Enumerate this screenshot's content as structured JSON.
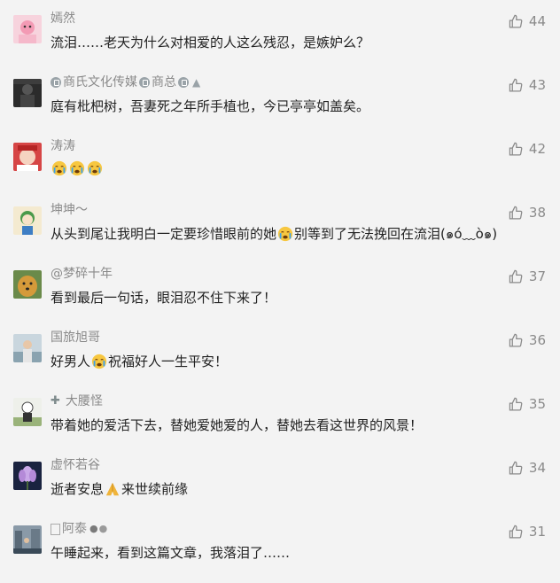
{
  "comments": [
    {
      "name": "嫣然",
      "badge": [],
      "text": [
        "流泪……老天为什么对相爱的人这么残忍，是嫉妒么？"
      ],
      "likes": "44",
      "avatar": "pink-cartoon"
    },
    {
      "name": "商氏文化传媒 商总",
      "badge": [
        "money-bag",
        "money-bag",
        "poop"
      ],
      "text": [
        "庭有枇杷树，吾妻死之年所手植也，今已亭亭如盖矣。"
      ],
      "likes": "43",
      "avatar": "dark-figure"
    },
    {
      "name": "涛涛",
      "badge": [],
      "text": [],
      "emojis": 3,
      "likes": "42",
      "avatar": "red-child"
    },
    {
      "name": "坤坤～",
      "badge": [],
      "text": [
        "从头到尾让我明白一定要珍惜眼前的她",
        "别等到了无法挽回在流泪(๑ó﹏ò๑)"
      ],
      "likes": "38",
      "avatar": "green-cartoon"
    },
    {
      "name": "@梦碎十年",
      "badge": [],
      "text": [
        "看到最后一句话，眼泪忍不住下来了！"
      ],
      "likes": "37",
      "avatar": "golden-dog"
    },
    {
      "name": "国旅旭哥",
      "badge": [],
      "text": [
        "好男人",
        "祝福好人一生平安！"
      ],
      "likes": "36",
      "avatar": "man-outdoor"
    },
    {
      "name": "大腰怪",
      "badge": [
        "cactus"
      ],
      "text": [
        "带着她的爱活下去，替她爱她爱的人，替她去看这世界的风景！"
      ],
      "likes": "35",
      "avatar": "cartoon-figure"
    },
    {
      "name": "虚怀若谷",
      "badge": [],
      "text": [
        "逝者安息",
        "来世续前缘"
      ],
      "likes": "34",
      "avatar": "lotus"
    },
    {
      "name": "阿泰",
      "badge": [
        "square",
        "dog",
        "cat"
      ],
      "text": [
        "午睡起来，看到这篇文章，我落泪了……"
      ],
      "likes": "31",
      "avatar": "city-street"
    }
  ],
  "icons": {
    "like": "thumbs-up-icon",
    "crying": "crying-emoji-icon",
    "pray": "praying-hands-emoji-icon"
  },
  "colors": {
    "background": "#f3f3f3",
    "name": "#8a8a8a",
    "text": "#222222",
    "likes": "#8a8a8a"
  }
}
